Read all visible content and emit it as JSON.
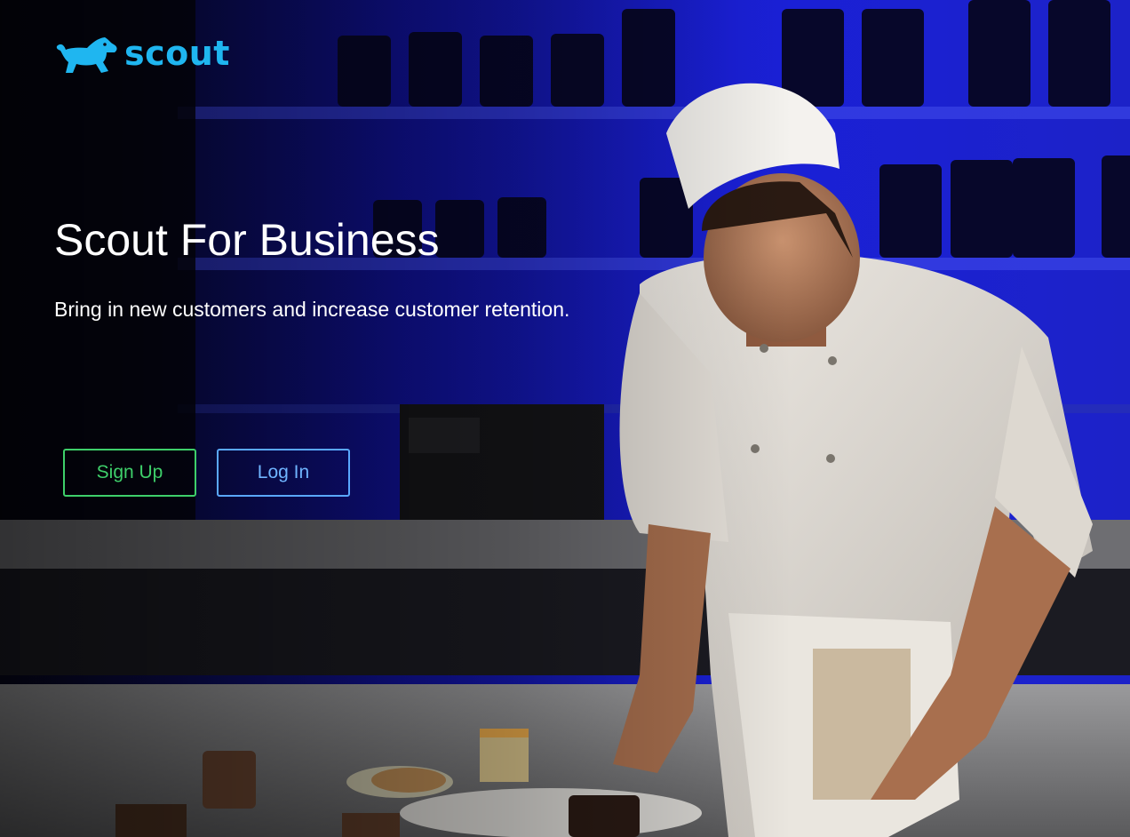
{
  "brand": {
    "name": "scout",
    "color": "#1fb6f0"
  },
  "hero": {
    "title": "Scout For Business",
    "subtitle": "Bring in new customers and increase customer retention."
  },
  "actions": {
    "signup_label": "Sign Up",
    "login_label": "Log In",
    "signup_color": "#3ecf6a",
    "login_color": "#5aa8ff"
  }
}
